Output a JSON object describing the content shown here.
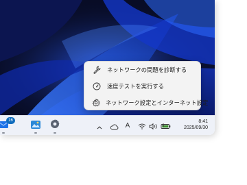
{
  "context_menu": {
    "items": [
      {
        "label": "ネットワークの問題を診断する",
        "icon": "wrench-icon"
      },
      {
        "label": "速度テストを実行する",
        "icon": "speedometer-icon"
      },
      {
        "label": "ネットワーク設定とインターネット設定",
        "icon": "gear-icon"
      }
    ]
  },
  "taskbar": {
    "badge": "16",
    "apps": [
      "mail-app-icon",
      "photos-app-icon",
      "settings-app-icon"
    ]
  },
  "tray": {
    "input_indicator": "A",
    "icons": [
      "chevron-up-icon",
      "onedrive-cloud-icon",
      "wifi-icon",
      "volume-icon",
      "battery-charging-icon"
    ]
  },
  "clock": {
    "time": "8:41",
    "date": "2025/09/30"
  },
  "colors": {
    "accent": "#0067c0",
    "badge": "#0f6cbd",
    "battery": "#3a8d2a"
  }
}
